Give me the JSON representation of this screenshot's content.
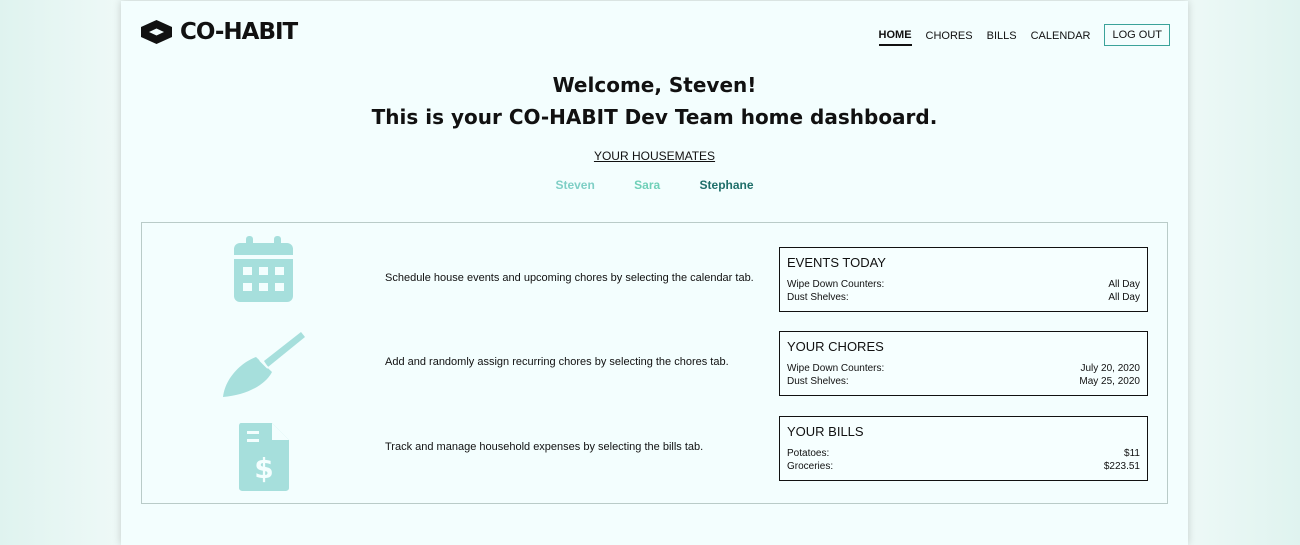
{
  "app": {
    "logo_text": "CO-HABIT"
  },
  "nav": {
    "items": [
      {
        "label": "HOME",
        "active": true
      },
      {
        "label": "CHORES",
        "active": false
      },
      {
        "label": "BILLS",
        "active": false
      },
      {
        "label": "CALENDAR",
        "active": false
      }
    ],
    "logout_label": "LOG OUT"
  },
  "welcome": {
    "line1": "Welcome, Steven!",
    "line2": "This is your CO-HABIT Dev Team home dashboard."
  },
  "housemates": {
    "title": "YOUR HOUSEMATES",
    "members": [
      {
        "name": "Steven",
        "color": "#7fcfc6"
      },
      {
        "name": "Sara",
        "color": "#6fd0b8"
      },
      {
        "name": "Stephane",
        "color": "#1f6f6a"
      }
    ]
  },
  "colors": {
    "icon_color": "#a6dfdc",
    "accent": "#3aa39a"
  },
  "rows": [
    {
      "icon": "calendar-icon",
      "text": "Schedule house events and upcoming chores by selecting the calendar tab.",
      "card": {
        "title": "EVENTS TODAY",
        "items": [
          {
            "label": "Wipe Down Counters:",
            "value": "All Day"
          },
          {
            "label": "Dust Shelves:",
            "value": "All Day"
          }
        ]
      }
    },
    {
      "icon": "broom-icon",
      "text": "Add and randomly assign recurring chores by selecting the chores tab.",
      "card": {
        "title": "YOUR CHORES",
        "items": [
          {
            "label": "Wipe Down Counters:",
            "value": "July 20, 2020"
          },
          {
            "label": "Dust Shelves:",
            "value": "May 25, 2020"
          }
        ]
      }
    },
    {
      "icon": "bill-document-icon",
      "text": "Track and manage household expenses by selecting the bills tab.",
      "card": {
        "title": "YOUR BILLS",
        "items": [
          {
            "label": "Potatoes:",
            "value": "$11"
          },
          {
            "label": "Groceries:",
            "value": "$223.51"
          }
        ]
      }
    }
  ]
}
